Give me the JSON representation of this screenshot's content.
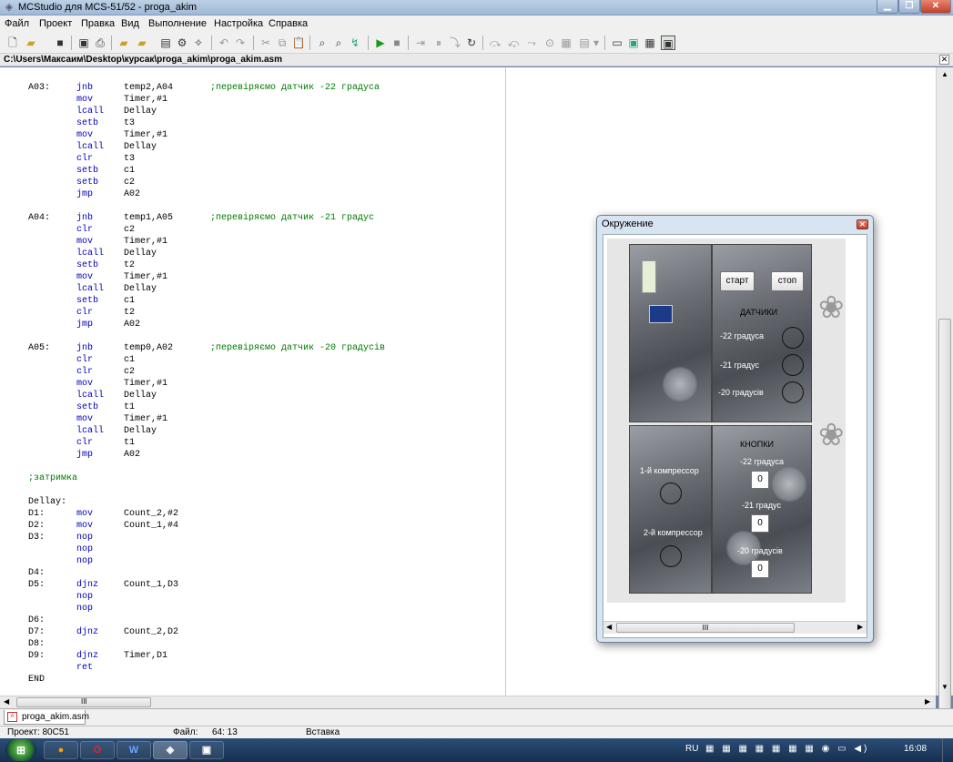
{
  "window": {
    "title": "MCStudio для MCS-51/52 - proga_akim"
  },
  "menu": [
    "Файл",
    "Проект",
    "Правка",
    "Вид",
    "Выполнение",
    "Настройка",
    "Справка"
  ],
  "path": "C:\\Users\\Максаим\\Desktop\\курсак\\proga_akim\\proga_akim.asm",
  "code": [
    {
      "label": "A03:",
      "op": "jnb",
      "arg": "temp2,A04",
      "comment": ";перевіряємо датчик -22 градуса"
    },
    {
      "label": "",
      "op": "mov",
      "arg": "Timer,#1",
      "comment": ""
    },
    {
      "label": "",
      "op": "lcall",
      "arg": "Dellay",
      "comment": ""
    },
    {
      "label": "",
      "op": "setb",
      "arg": "t3",
      "comment": ""
    },
    {
      "label": "",
      "op": "mov",
      "arg": "Timer,#1",
      "comment": ""
    },
    {
      "label": "",
      "op": "lcall",
      "arg": "Dellay",
      "comment": ""
    },
    {
      "label": "",
      "op": "clr",
      "arg": "t3",
      "comment": ""
    },
    {
      "label": "",
      "op": "setb",
      "arg": "c1",
      "comment": ""
    },
    {
      "label": "",
      "op": "setb",
      "arg": "c2",
      "comment": ""
    },
    {
      "label": "",
      "op": "jmp",
      "arg": "A02",
      "comment": ""
    },
    {
      "label": "",
      "op": "",
      "arg": "",
      "comment": ""
    },
    {
      "label": "A04:",
      "op": "jnb",
      "arg": "temp1,A05",
      "comment": ";перевіряємо датчик -21 градус"
    },
    {
      "label": "",
      "op": "clr",
      "arg": "c2",
      "comment": ""
    },
    {
      "label": "",
      "op": "mov",
      "arg": "Timer,#1",
      "comment": ""
    },
    {
      "label": "",
      "op": "lcall",
      "arg": "Dellay",
      "comment": ""
    },
    {
      "label": "",
      "op": "setb",
      "arg": "t2",
      "comment": ""
    },
    {
      "label": "",
      "op": "mov",
      "arg": "Timer,#1",
      "comment": ""
    },
    {
      "label": "",
      "op": "lcall",
      "arg": "Dellay",
      "comment": ""
    },
    {
      "label": "",
      "op": "setb",
      "arg": "c1",
      "comment": ""
    },
    {
      "label": "",
      "op": "clr",
      "arg": "t2",
      "comment": ""
    },
    {
      "label": "",
      "op": "jmp",
      "arg": "A02",
      "comment": ""
    },
    {
      "label": "",
      "op": "",
      "arg": "",
      "comment": ""
    },
    {
      "label": "A05:",
      "op": "jnb",
      "arg": "temp0,A02",
      "comment": ";перевіряємо датчик -20 градусів"
    },
    {
      "label": "",
      "op": "clr",
      "arg": "c1",
      "comment": ""
    },
    {
      "label": "",
      "op": "clr",
      "arg": "c2",
      "comment": ""
    },
    {
      "label": "",
      "op": "mov",
      "arg": "Timer,#1",
      "comment": ""
    },
    {
      "label": "",
      "op": "lcall",
      "arg": "Dellay",
      "comment": ""
    },
    {
      "label": "",
      "op": "setb",
      "arg": "t1",
      "comment": ""
    },
    {
      "label": "",
      "op": "mov",
      "arg": "Timer,#1",
      "comment": ""
    },
    {
      "label": "",
      "op": "lcall",
      "arg": "Dellay",
      "comment": ""
    },
    {
      "label": "",
      "op": "clr",
      "arg": "t1",
      "comment": ""
    },
    {
      "label": "",
      "op": "jmp",
      "arg": "A02",
      "comment": ""
    },
    {
      "label": "",
      "op": "",
      "arg": "",
      "comment": ""
    },
    {
      "label": "",
      "op": "",
      "arg": "",
      "comment": ";затримка"
    },
    {
      "label": "",
      "op": "",
      "arg": "",
      "comment": ""
    },
    {
      "label": "Dellay:",
      "op": "",
      "arg": "",
      "comment": ""
    },
    {
      "label": "D1:",
      "op": "mov",
      "arg": "Count_2,#2",
      "comment": ""
    },
    {
      "label": "D2:",
      "op": "mov",
      "arg": "Count_1,#4",
      "comment": ""
    },
    {
      "label": "D3:",
      "op": "nop",
      "arg": "",
      "comment": ""
    },
    {
      "label": "",
      "op": "nop",
      "arg": "",
      "comment": ""
    },
    {
      "label": "",
      "op": "nop",
      "arg": "",
      "comment": ""
    },
    {
      "label": "D4:",
      "op": "",
      "arg": "",
      "comment": ""
    },
    {
      "label": "D5:",
      "op": "djnz",
      "arg": "Count_1,D3",
      "comment": ""
    },
    {
      "label": "",
      "op": "nop",
      "arg": "",
      "comment": ""
    },
    {
      "label": "",
      "op": "nop",
      "arg": "",
      "comment": ""
    },
    {
      "label": "D6:",
      "op": "",
      "arg": "",
      "comment": ""
    },
    {
      "label": "D7:",
      "op": "djnz",
      "arg": "Count_2,D2",
      "comment": ""
    },
    {
      "label": "D8:",
      "op": "",
      "arg": "",
      "comment": ""
    },
    {
      "label": "D9:",
      "op": "djnz",
      "arg": "Timer,D1",
      "comment": ""
    },
    {
      "label": "",
      "op": "ret",
      "arg": "",
      "comment": ""
    },
    {
      "label": "END",
      "op": "",
      "arg": "",
      "comment": ""
    }
  ],
  "tab": {
    "file": "proga_akim.asm"
  },
  "status": {
    "project": "Проект: 80C51",
    "file_label": "Файл:",
    "position": "64: 13",
    "mode": "Вставка"
  },
  "dialog": {
    "title": "Окружение",
    "start": "старт",
    "stop": "стоп",
    "sensors_title": "ДАТЧИКИ",
    "sensor_labels": [
      "-22 градуса",
      "-21 градус",
      "-20 градусів"
    ],
    "buttons_title": "КНОПКИ",
    "button_labels": [
      "-22 градуса",
      "-21 градус",
      "-20 градусів"
    ],
    "button_values": [
      "0",
      "0",
      "0"
    ],
    "compressor1": "1-й компрессор",
    "compressor2": "2-й компрессор",
    "scroll_mark": "III"
  },
  "taskbar": {
    "lang": "RU",
    "time": "16:08"
  },
  "scroll_mark": "III"
}
